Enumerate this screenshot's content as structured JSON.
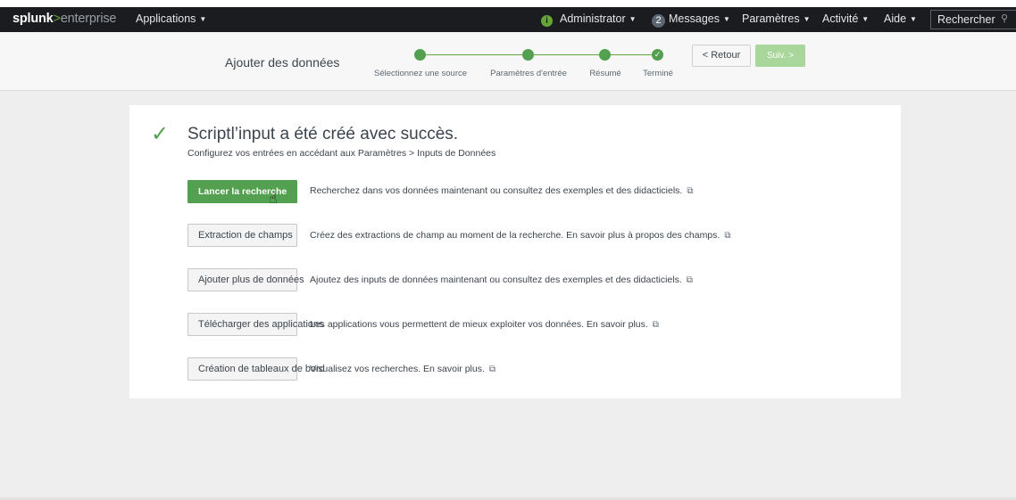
{
  "brand": {
    "bold": "splunk",
    "gt": ">",
    "rest": "enterprise"
  },
  "nav": {
    "applications": "Applications",
    "admin": "Administrator",
    "messages_count": "2",
    "messages": "Messages",
    "settings": "Paramètres",
    "activity": "Activité",
    "help": "Aide",
    "search_placeholder": "Rechercher"
  },
  "wizard": {
    "title": "Ajouter des données",
    "steps": [
      "Sélectionnez une source",
      "Paramètres d'entrée",
      "Résumé",
      "Terminé"
    ],
    "back_label": "< Retour",
    "next_label": "Suiv. >"
  },
  "success": {
    "title": "Scriptl’input a été créé avec succès.",
    "subtitle": "Configurez vos entrées en accédant aux Paramètres > Inputs de Données"
  },
  "actions": [
    {
      "label": "Lancer la recherche",
      "desc": "Recherchez dans vos données maintenant ou consultez des exemples et des didacticiels."
    },
    {
      "label": "Extraction de champs",
      "desc": "Créez des extractions de champ au moment de la recherche. En savoir plus à propos des champs."
    },
    {
      "label": "Ajouter plus de données",
      "desc": "Ajoutez des inputs de données maintenant ou consultez des exemples et des didacticiels."
    },
    {
      "label": "Télécharger des applications",
      "desc": "Les applications vous permettent de mieux exploiter vos données. En savoir plus."
    },
    {
      "label": "Création de tableaux de bord",
      "desc": "Visualisez vos recherches. En savoir plus."
    }
  ],
  "colors": {
    "accent_green": "#53a051",
    "topbar": "#1a1c20"
  }
}
